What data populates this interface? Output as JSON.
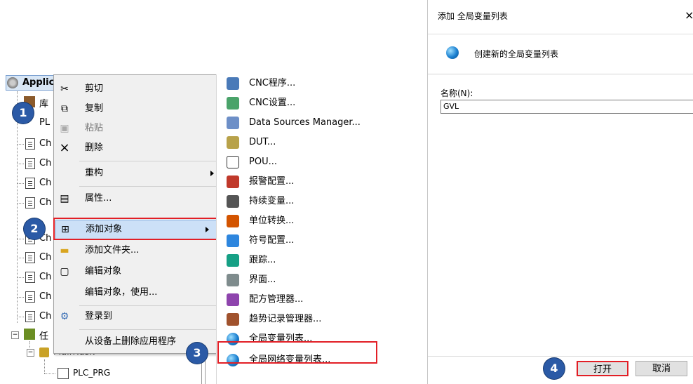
{
  "tree": {
    "root_label": "Applic",
    "items": [
      "库",
      "PL",
      "Ch",
      "Ch",
      "Ch",
      "Ch",
      "Ch",
      "Ch",
      "Ch",
      "Ch",
      "Ch"
    ],
    "task_root": "任",
    "main_task": "MainTask",
    "plc_prg": "PLC_PRG"
  },
  "context_menu": {
    "items": [
      {
        "label": "剪切",
        "icon": "scissors-icon"
      },
      {
        "label": "复制",
        "icon": "copy-icon"
      },
      {
        "label": "粘贴",
        "icon": "paste-icon"
      },
      {
        "label": "删除",
        "icon": "delete-icon"
      },
      {
        "label": "重构",
        "icon": ""
      },
      {
        "label": "属性...",
        "icon": "properties-icon"
      },
      {
        "label": "添加对象",
        "icon": "add-object-icon"
      },
      {
        "label": "添加文件夹...",
        "icon": "folder-icon"
      },
      {
        "label": "编辑对象",
        "icon": "edit-object-icon"
      },
      {
        "label": "编辑对象，使用...",
        "icon": ""
      },
      {
        "label": "登录到",
        "icon": "login-icon"
      },
      {
        "label": "从设备上删除应用程序",
        "icon": ""
      }
    ]
  },
  "submenu": {
    "items": [
      {
        "label": "CNC程序..."
      },
      {
        "label": "CNC设置..."
      },
      {
        "label": "Data Sources Manager..."
      },
      {
        "label": "DUT..."
      },
      {
        "label": "POU..."
      },
      {
        "label": "报警配置..."
      },
      {
        "label": "持续变量..."
      },
      {
        "label": "单位转换..."
      },
      {
        "label": "符号配置..."
      },
      {
        "label": "跟踪..."
      },
      {
        "label": "界面..."
      },
      {
        "label": "配方管理器..."
      },
      {
        "label": "趋势记录管理器..."
      },
      {
        "label": "全局变量列表..."
      },
      {
        "label": "全局网络变量列表..."
      }
    ]
  },
  "dialog": {
    "title": "添加 全局变量列表",
    "close": "×",
    "subtitle": "创建新的全局变量列表",
    "name_label": "名称(N):",
    "name_value": "GVL",
    "open_button": "打开",
    "cancel_button": "取消"
  },
  "badges": [
    "1",
    "2",
    "3",
    "4"
  ],
  "colors": {
    "highlight": "#e21f26",
    "badge": "#2b5aa6"
  }
}
